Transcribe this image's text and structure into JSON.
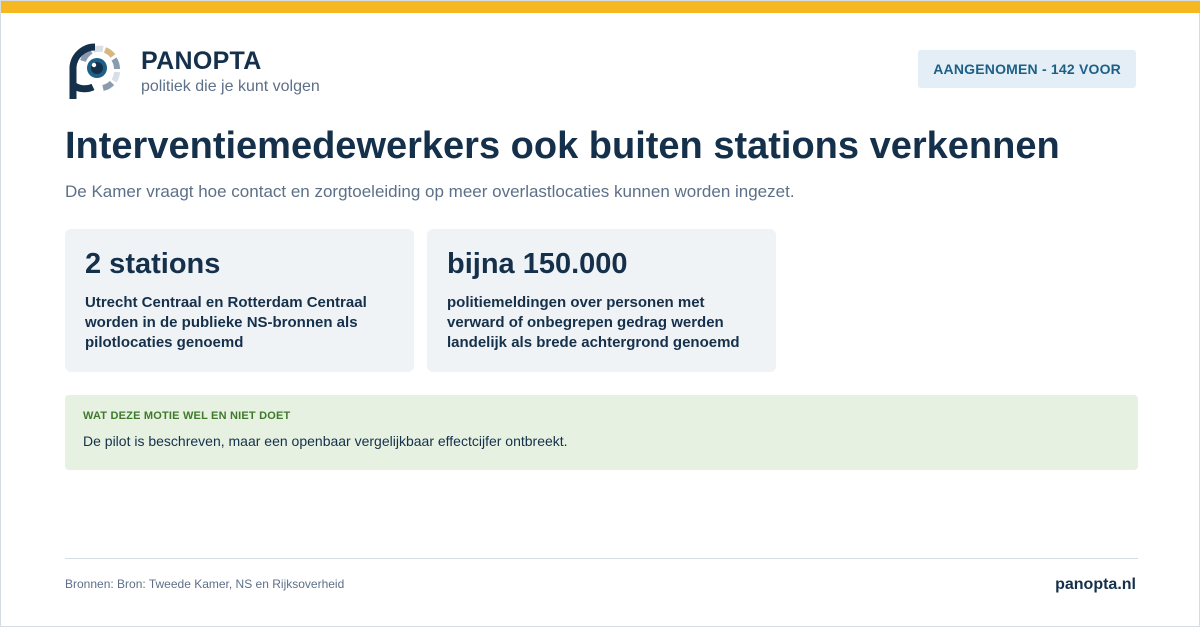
{
  "brand": {
    "name": "PANOPTA",
    "tagline": "politiek die je kunt volgen",
    "logo_icon": "panopta-eye-logo-icon",
    "colors": {
      "navy": "#15304a",
      "gold": "#d7b680",
      "slate": "#8a9bb0",
      "pale": "#d8dfe7",
      "blue": "#1f5f86"
    }
  },
  "badge": {
    "label": "AANGENOMEN - 142 VOOR"
  },
  "headline": {
    "title": "Interventiemedewerkers ook buiten stations verkennen",
    "subtitle": "De Kamer vraagt hoe contact en zorgtoeleiding op meer overlastlocaties kunnen worden ingezet."
  },
  "stats": [
    {
      "value": "2 stations",
      "description": "Utrecht Centraal en Rotterdam Centraal worden in de publieke NS-bronnen als pilotlocaties genoemd"
    },
    {
      "value": "bijna 150.000",
      "description": "politiemeldingen over personen met verward of onbegrepen gedrag werden landelijk als brede achtergrond genoemd"
    }
  ],
  "note": {
    "heading": "WAT DEZE MOTIE WEL EN NIET DOET",
    "text": "De pilot is beschreven, maar een openbaar vergelijkbaar effectcijfer ontbreekt."
  },
  "footer": {
    "sources": "Bronnen: Bron: Tweede Kamer, NS en Rijksoverheid",
    "site": "panopta.nl"
  },
  "colors": {
    "accent_bar": "#f5b820",
    "badge_bg": "#e4eef6",
    "stat_bg": "#f0f3f6",
    "note_bg": "#e6f1e2",
    "note_heading": "#3f7a2c"
  }
}
